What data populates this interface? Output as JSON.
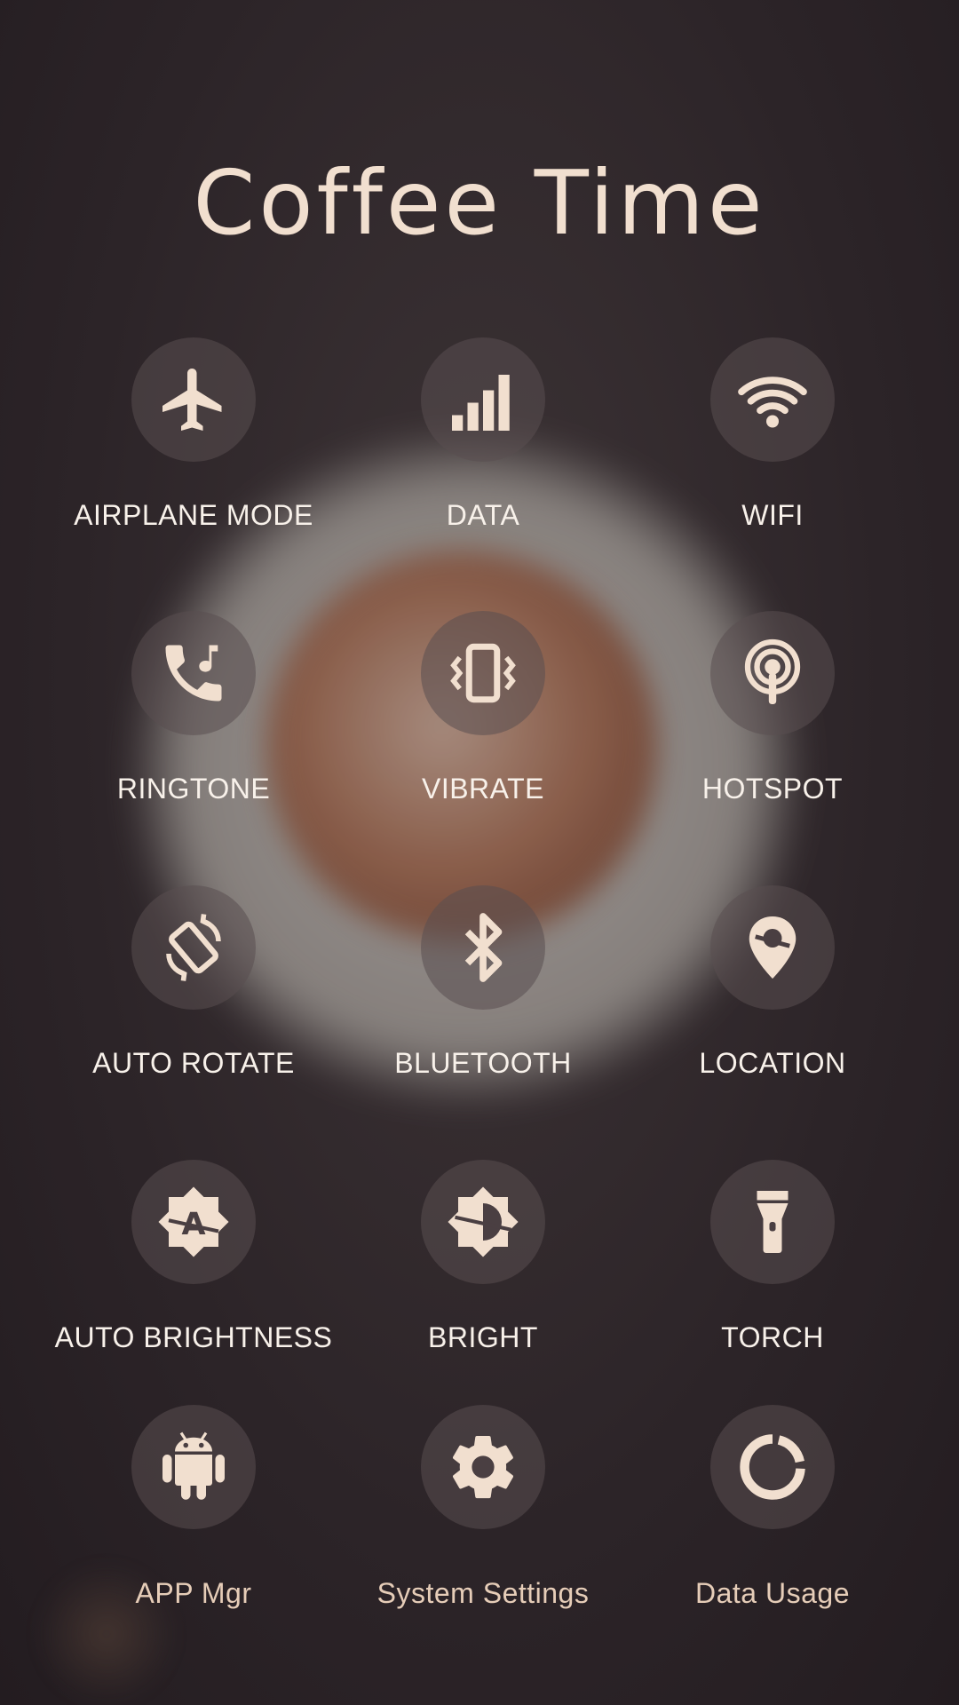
{
  "title": "Coffee Time",
  "accent_color": "#f1dfcf",
  "tiles": [
    {
      "label": "AIRPLANE MODE",
      "icon": "airplane-icon"
    },
    {
      "label": "DATA",
      "icon": "signal-bars-icon"
    },
    {
      "label": "WIFI",
      "icon": "wifi-icon"
    },
    {
      "label": "RINGTONE",
      "icon": "ringtone-phone-icon"
    },
    {
      "label": "VIBRATE",
      "icon": "vibrate-phone-icon"
    },
    {
      "label": "HOTSPOT",
      "icon": "hotspot-icon"
    },
    {
      "label": "AUTO ROTATE",
      "icon": "auto-rotate-icon"
    },
    {
      "label": "BLUETOOTH",
      "icon": "bluetooth-icon"
    },
    {
      "label": "LOCATION",
      "icon": "location-pin-icon"
    },
    {
      "label": "AUTO BRIGHTNESS",
      "icon": "auto-brightness-icon"
    },
    {
      "label": "BRIGHT",
      "icon": "brightness-icon"
    },
    {
      "label": "TORCH",
      "icon": "torch-icon"
    },
    {
      "label": "APP Mgr",
      "icon": "android-icon"
    },
    {
      "label": "System Settings",
      "icon": "gear-icon"
    },
    {
      "label": "Data Usage",
      "icon": "data-usage-ring-icon"
    }
  ]
}
